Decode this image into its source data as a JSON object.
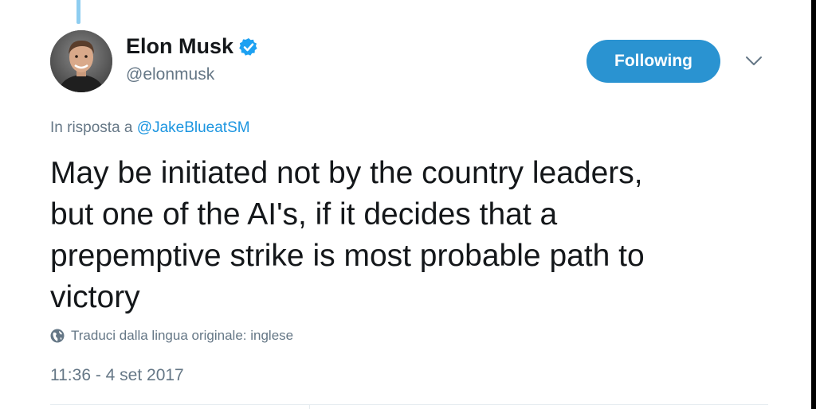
{
  "tweet": {
    "author": {
      "name": "Elon Musk",
      "handle": "@elonmusk",
      "verified": true,
      "avatar_icon": "profile-photo"
    },
    "follow_button_label": "Following",
    "reply_prefix": "In risposta a",
    "reply_to": "@JakeBlueatSM",
    "text": "May be initiated not by the country leaders,\nbut one of the AI's, if it decides that a\nprepemptive strike is most probable path to\nvictory",
    "translate_label": "Traduci dalla lingua originale: inglese",
    "timestamp": "11:36 - 4 set 2017"
  },
  "colors": {
    "accent": "#1b95e0",
    "button_bg": "#2a93d1",
    "secondary_text": "#657786",
    "thread_line": "#8ecdf0"
  }
}
